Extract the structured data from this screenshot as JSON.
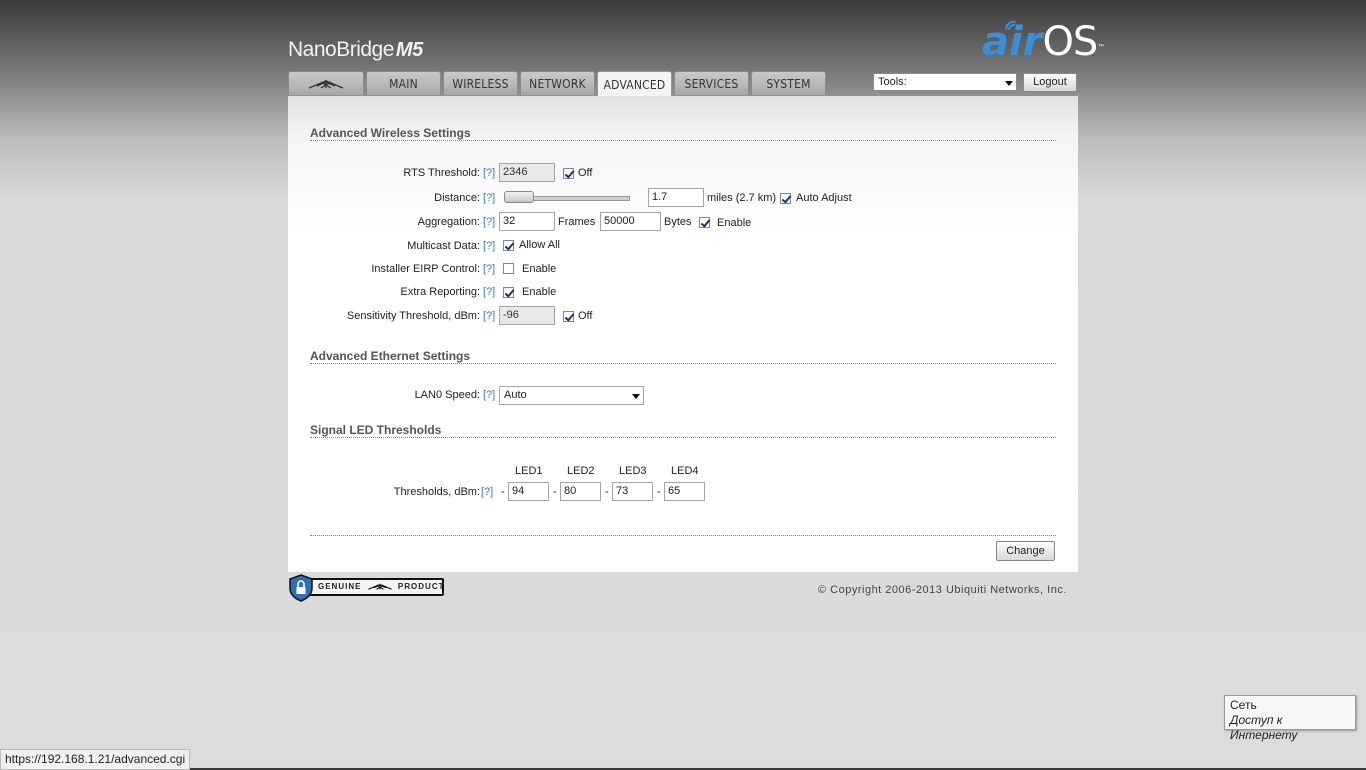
{
  "header": {
    "brand": "NanoBridge",
    "brand_model": "M5",
    "airos_air": "air",
    "airos_os": "OS",
    "airos_tm": "™"
  },
  "tabs": [
    {
      "label": "",
      "icon": "ubiquiti-logo-icon"
    },
    {
      "label": "MAIN"
    },
    {
      "label": "WIRELESS"
    },
    {
      "label": "NETWORK"
    },
    {
      "label": "ADVANCED"
    },
    {
      "label": "SERVICES"
    },
    {
      "label": "SYSTEM"
    }
  ],
  "active_tab": "ADVANCED",
  "tools": {
    "selected": "Tools:"
  },
  "logout_label": "Logout",
  "help_label": "[?]",
  "wireless": {
    "title": "Advanced Wireless Settings",
    "rts": {
      "label": "RTS Threshold:",
      "value": "2346",
      "off_label": "Off",
      "off_checked": true
    },
    "distance": {
      "label": "Distance:",
      "value": "1.7",
      "unit": "miles (2.7 km)",
      "auto_label": "Auto Adjust",
      "auto_checked": true,
      "slider_position": 0.1
    },
    "aggregation": {
      "label": "Aggregation:",
      "frames_value": "32",
      "frames_label": "Frames",
      "bytes_value": "50000",
      "bytes_label": "Bytes",
      "enable_label": "Enable",
      "enable_checked": true
    },
    "multicast": {
      "label": "Multicast Data:",
      "option_label": "Allow All",
      "checked": true
    },
    "eirp": {
      "label": "Installer EIRP Control:",
      "option_label": "Enable",
      "checked": false
    },
    "reporting": {
      "label": "Extra Reporting:",
      "option_label": "Enable",
      "checked": true
    },
    "sensitivity": {
      "label": "Sensitivity Threshold, dBm:",
      "value": "-96",
      "off_label": "Off",
      "off_checked": true
    }
  },
  "ethernet": {
    "title": "Advanced Ethernet Settings",
    "lan0": {
      "label": "LAN0 Speed:",
      "selected": "Auto"
    }
  },
  "led": {
    "title": "Signal LED Thresholds",
    "label": "Thresholds, dBm:",
    "dash": "-",
    "headers": [
      "LED1",
      "LED2",
      "LED3",
      "LED4"
    ],
    "values": [
      "94",
      "80",
      "73",
      "65"
    ]
  },
  "change_label": "Change",
  "footer": {
    "genuine_left": "GENUINE",
    "genuine_right": "PRODUCT",
    "copyright": "© Copyright 2006-2013 Ubiquiti Networks, Inc."
  },
  "statusbar": {
    "url": "https://192.168.1.21/advanced.cgi"
  },
  "network_tooltip": {
    "title": "Сеть",
    "subtitle": "Доступ к Интернету"
  },
  "colors": {
    "accent": "#3b8ed8",
    "help_link": "#3a7dc4"
  }
}
